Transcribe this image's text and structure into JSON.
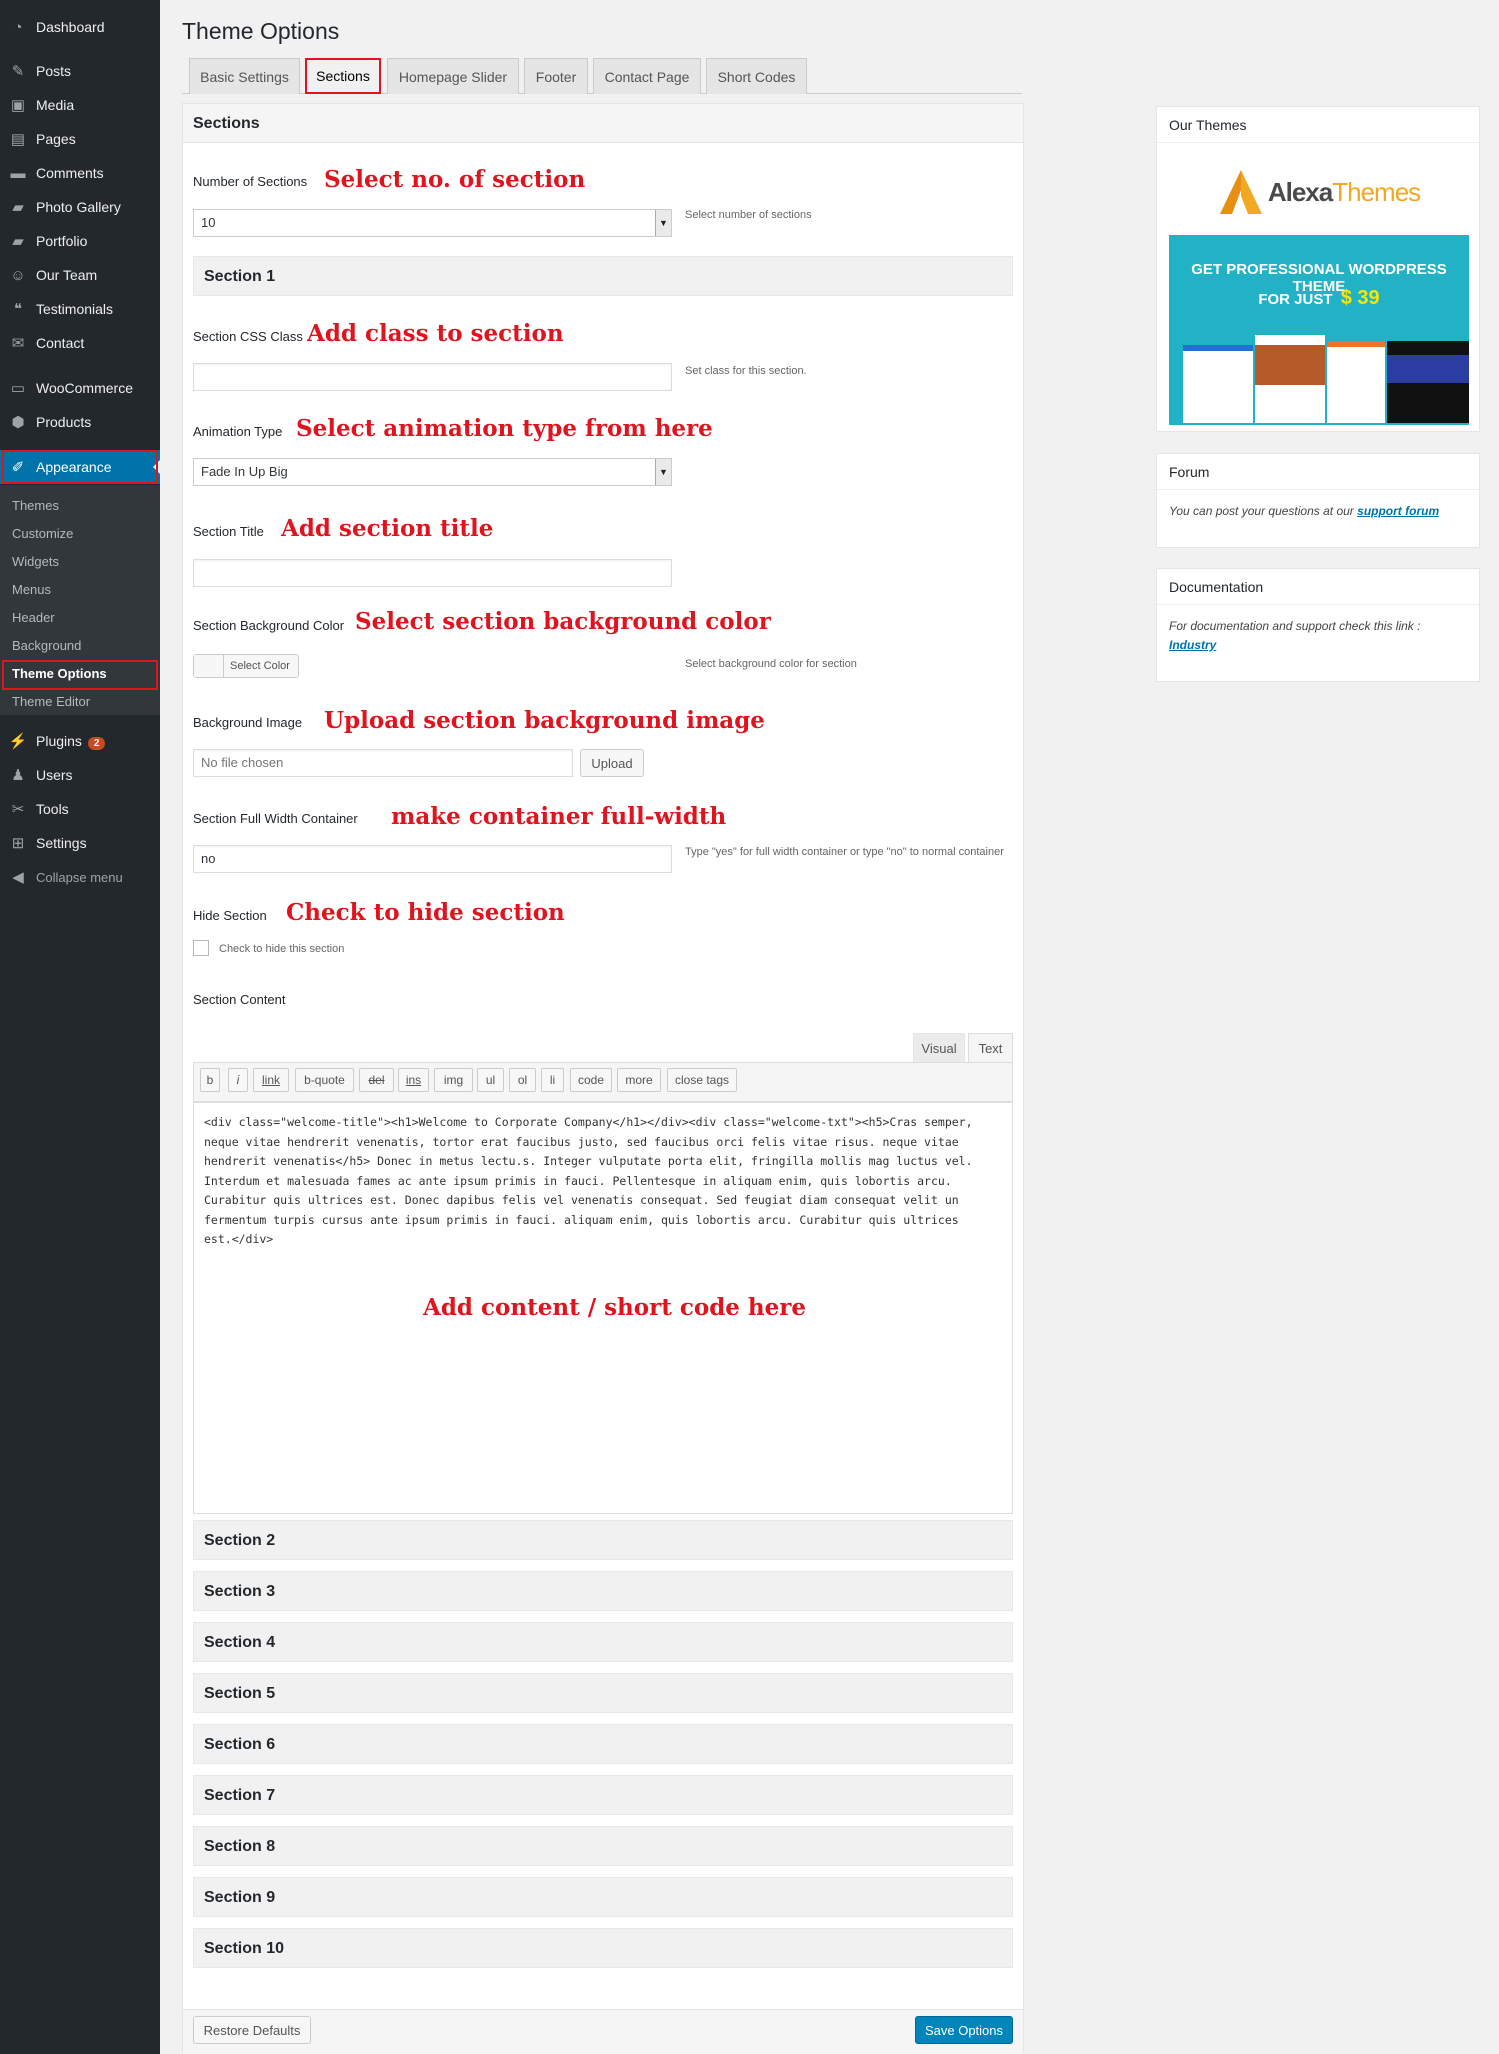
{
  "sidebar": {
    "items": [
      {
        "label": "Dashboard",
        "icon": "dashboard-icon"
      },
      {
        "label": "Posts",
        "icon": "pin-icon"
      },
      {
        "label": "Media",
        "icon": "media-icon"
      },
      {
        "label": "Pages",
        "icon": "pages-icon"
      },
      {
        "label": "Comments",
        "icon": "comment-icon"
      },
      {
        "label": "Photo Gallery",
        "icon": "folder-icon"
      },
      {
        "label": "Portfolio",
        "icon": "folder-icon"
      },
      {
        "label": "Our Team",
        "icon": "team-icon"
      },
      {
        "label": "Testimonials",
        "icon": "quote-icon"
      },
      {
        "label": "Contact",
        "icon": "mail-icon"
      },
      {
        "label": "WooCommerce",
        "icon": "woo-icon"
      },
      {
        "label": "Products",
        "icon": "box-icon"
      },
      {
        "label": "Appearance",
        "icon": "brush-icon"
      },
      {
        "label": "Plugins",
        "icon": "plug-icon",
        "badge": "2"
      },
      {
        "label": "Users",
        "icon": "user-icon"
      },
      {
        "label": "Tools",
        "icon": "wrench-icon"
      },
      {
        "label": "Settings",
        "icon": "settings-icon"
      },
      {
        "label": "Collapse menu",
        "icon": "collapse-icon"
      }
    ],
    "submenu": [
      "Themes",
      "Customize",
      "Widgets",
      "Menus",
      "Header",
      "Background",
      "Theme Options",
      "Theme Editor"
    ]
  },
  "page": {
    "title": "Theme Options"
  },
  "tabs": [
    "Basic Settings",
    "Sections",
    "Homepage Slider",
    "Footer",
    "Contact Page",
    "Short Codes"
  ],
  "panel": {
    "title": "Sections",
    "num_sections_label": "Number of Sections",
    "num_sections_value": "10",
    "num_sections_desc": "Select number of sections",
    "section1_title": "Section 1",
    "css_class_label": "Section CSS Class",
    "css_class_desc": "Set class for this section.",
    "animation_label": "Animation Type",
    "animation_value": "Fade In Up Big",
    "section_title_label": "Section Title",
    "bg_color_label": "Section Background Color",
    "select_color_btn": "Select Color",
    "bg_color_desc": "Select background color for section",
    "bg_image_label": "Background Image",
    "file_placeholder": "No file chosen",
    "upload_btn": "Upload",
    "full_width_label": "Section Full Width Container",
    "full_width_value": "no",
    "full_width_desc": "Type \"yes\" for full width container or type \"no\" to normal container",
    "hide_label": "Hide Section",
    "hide_checkbox_label": "Check to hide this section",
    "content_label": "Section Content",
    "editor_tab_visual": "Visual",
    "editor_tab_text": "Text",
    "quicktags": [
      "b",
      "i",
      "link",
      "b-quote",
      "del",
      "ins",
      "img",
      "ul",
      "ol",
      "li",
      "code",
      "more",
      "close tags"
    ],
    "editor_content": "<div class=\"welcome-title\"><h1>Welcome to Corporate Company</h1></div><div class=\"welcome-txt\"><h5>Cras semper,\nneque vitae hendrerit venenatis, tortor erat faucibus justo, sed faucibus orci felis vitae risus. neque vitae\nhendrerit venenatis</h5> Donec in metus lectu.s. Integer vulputate porta elit, fringilla mollis mag luctus vel.\nInterdum et malesuada fames ac ante ipsum primis in fauci. Pellentesque in aliquam enim, quis lobortis arcu.\nCurabitur quis ultrices est. Donec dapibus felis vel venenatis consequat. Sed feugiat diam consequat velit un\nfermentum turpis cursus ante ipsum primis in fauci. aliquam enim, quis lobortis arcu. Curabitur quis ultrices\nest.</div>",
    "sections_collapsed": [
      "Section 2",
      "Section 3",
      "Section 4",
      "Section 5",
      "Section 6",
      "Section 7",
      "Section 8",
      "Section 9",
      "Section 10"
    ],
    "restore_btn": "Restore Defaults",
    "save_btn": "Save Options"
  },
  "annotations": {
    "num_sections": "Select no. of section",
    "css_class": "Add class to section",
    "animation": "Select animation type from here",
    "title": "Add section title",
    "bg_color": "Select section background color",
    "bg_image": "Upload section background image",
    "full_width": "make container full-width",
    "hide": "Check to hide section",
    "content": "Add content / short code here"
  },
  "right": {
    "our_themes_title": "Our Themes",
    "ad_brand": "AlexaThemes",
    "ad_brand_a": "Alexa",
    "ad_brand_b": "Themes",
    "ad_line1": "GET PROFESSIONAL WORDPRESS THEME",
    "ad_line2": "FOR JUST",
    "ad_price": "$ 39",
    "forum_title": "Forum",
    "forum_text": "You can post your questions at our",
    "forum_link": "support forum",
    "doc_title": "Documentation",
    "doc_text": "For documentation and support check this link :",
    "doc_link": "Industry"
  },
  "colors": {
    "accent": "#0073aa",
    "annotation": "#e0141e",
    "sidebar": "#23282d"
  }
}
